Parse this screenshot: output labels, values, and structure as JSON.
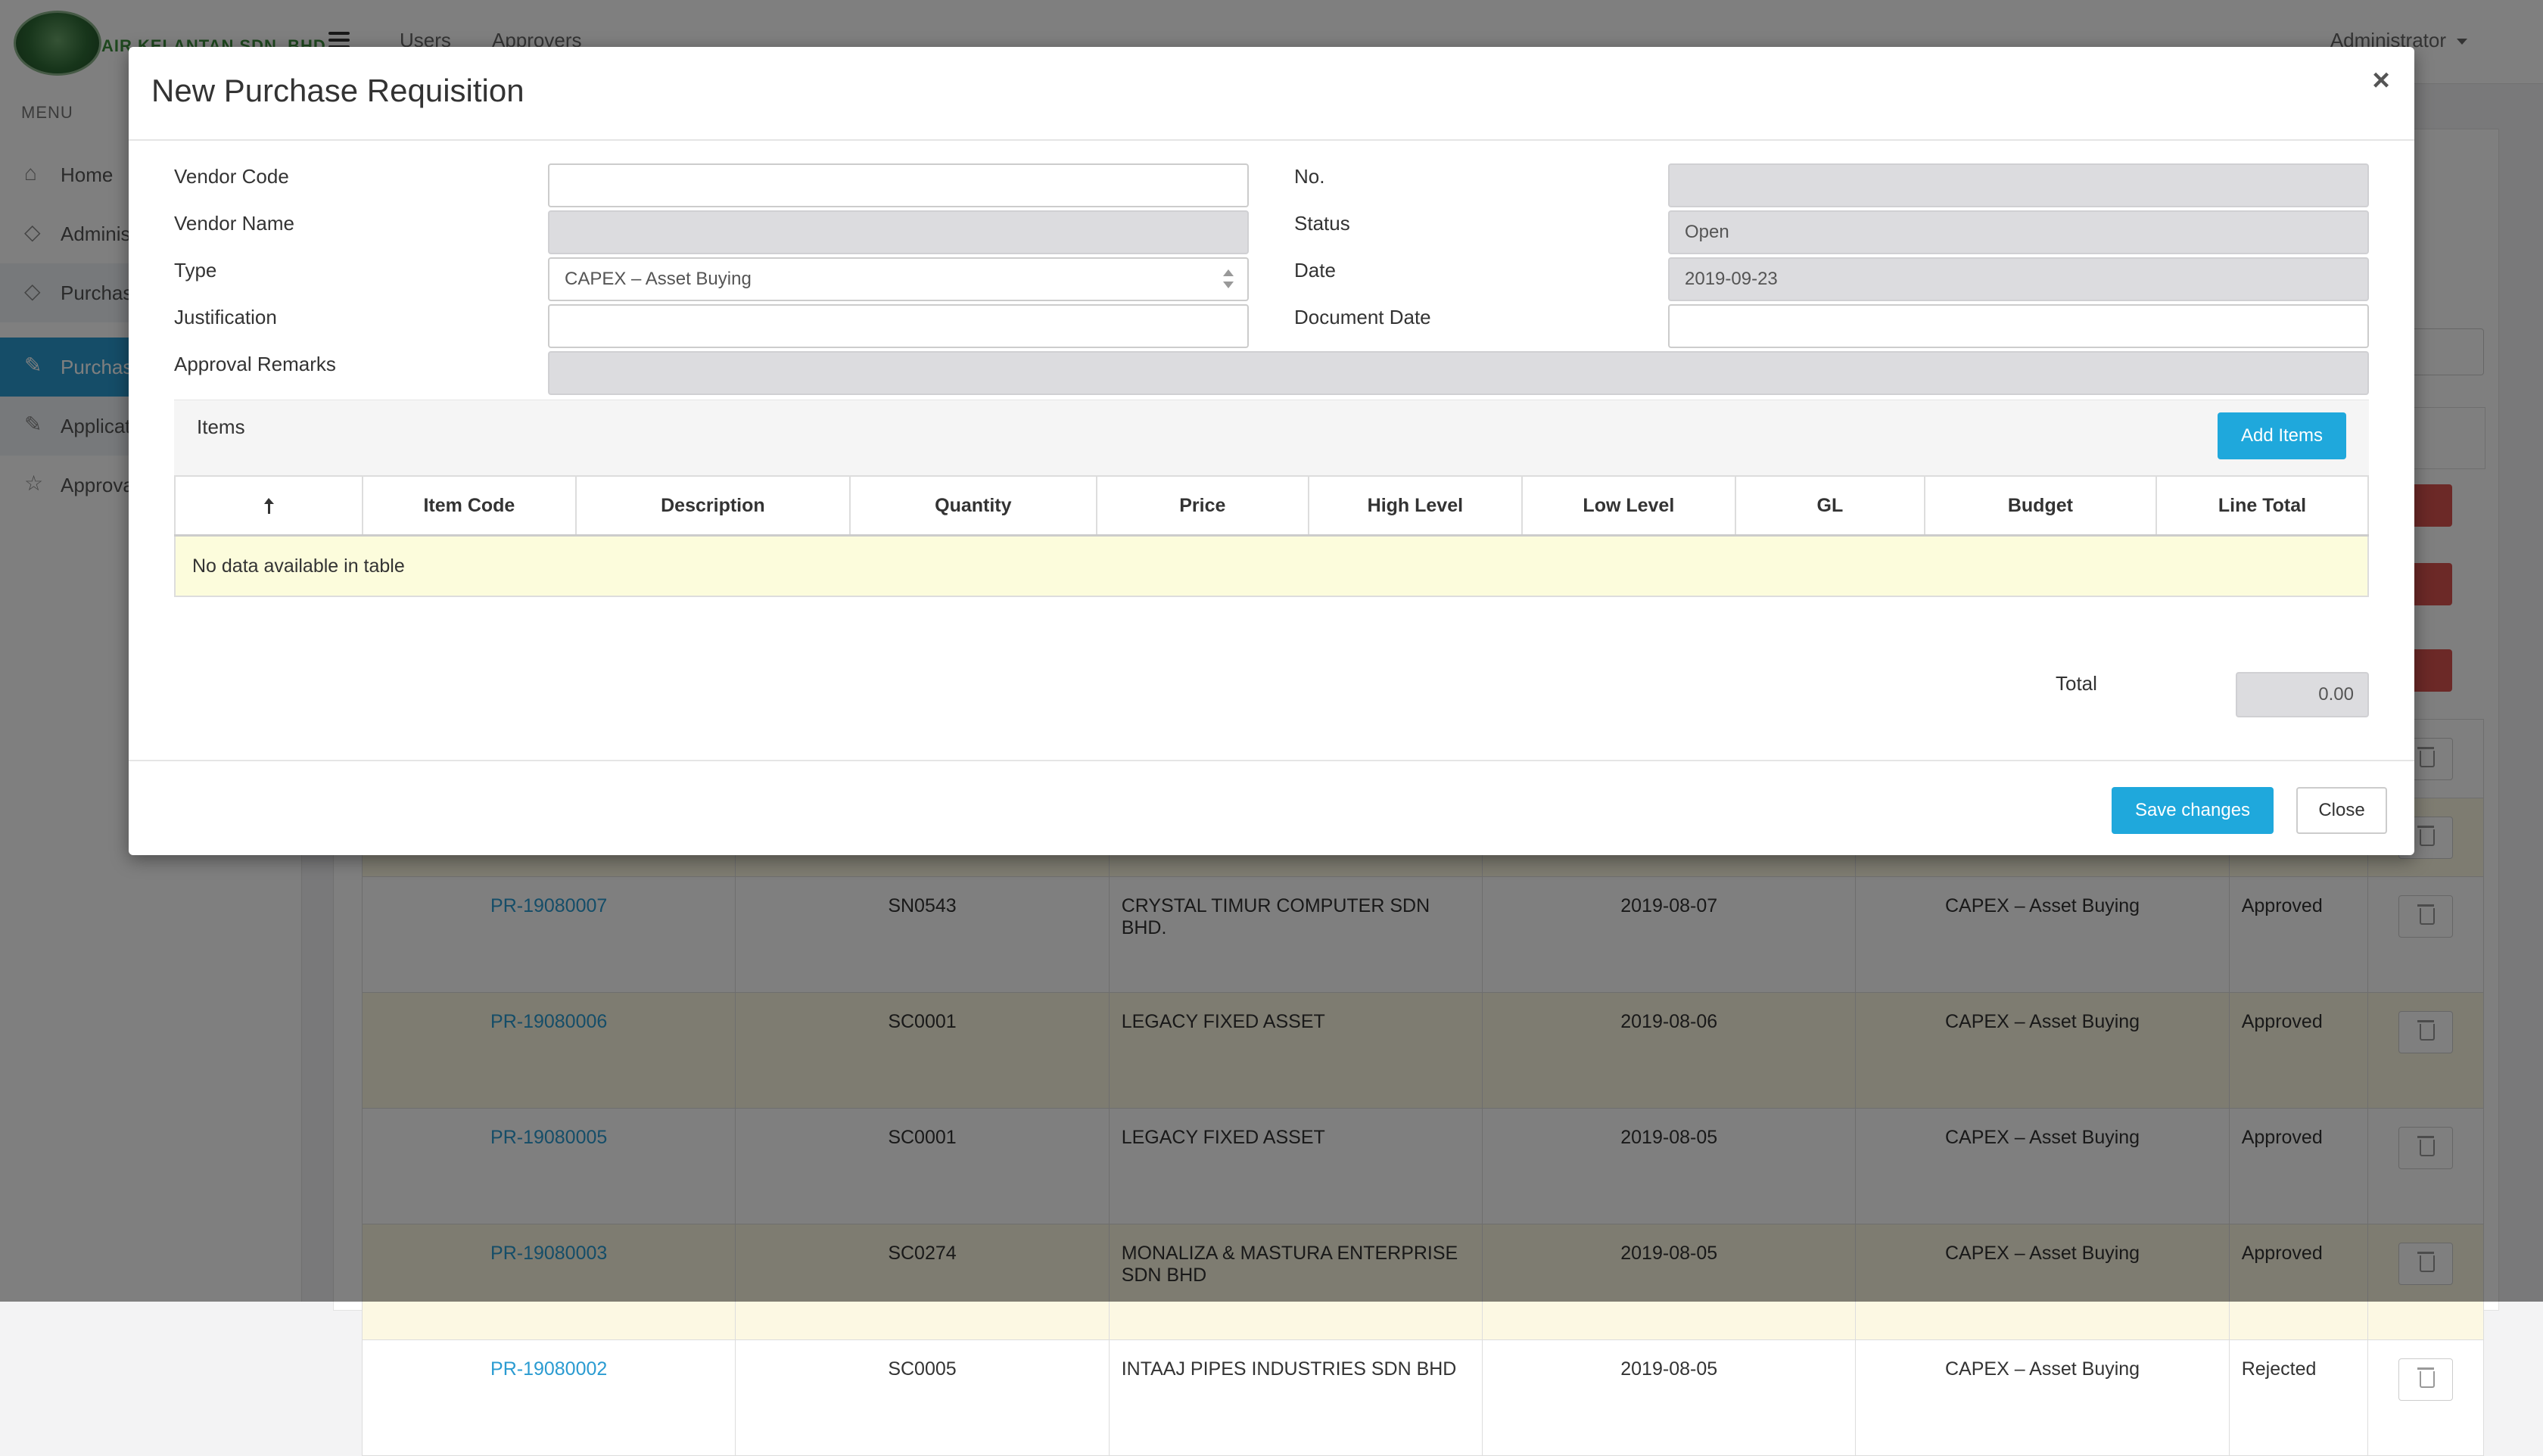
{
  "app": {
    "brand": "AIR KELANTAN SDN. BHD.",
    "nav": [
      "Users",
      "Approvers"
    ],
    "user_menu": "Administrator"
  },
  "sidebar": {
    "header": "MENU",
    "items": [
      {
        "label": "Home",
        "icon": "home-icon"
      },
      {
        "label": "Administration",
        "icon": "tags-icon"
      },
      {
        "label": "Purchase",
        "icon": "tags-icon"
      },
      {
        "label": "Purchase Requisition",
        "icon": "edit-icon"
      },
      {
        "label": "Application",
        "icon": "edit-icon"
      },
      {
        "label": "Approval",
        "icon": "star-icon"
      }
    ]
  },
  "background_table": {
    "rows": [
      {
        "no": "PR-19080007",
        "code": "SN0543",
        "vendor": "CRYSTAL TIMUR COMPUTER SDN BHD.",
        "date": "2019-08-07",
        "type": "CAPEX – Asset Buying",
        "status": "Approved"
      },
      {
        "no": "PR-19080006",
        "code": "SC0001",
        "vendor": "LEGACY FIXED ASSET",
        "date": "2019-08-06",
        "type": "CAPEX – Asset Buying",
        "status": "Approved"
      },
      {
        "no": "PR-19080005",
        "code": "SC0001",
        "vendor": "LEGACY FIXED ASSET",
        "date": "2019-08-05",
        "type": "CAPEX – Asset Buying",
        "status": "Approved"
      },
      {
        "no": "PR-19080003",
        "code": "SC0274",
        "vendor": "MONALIZA & MASTURA ENTERPRISE SDN BHD",
        "date": "2019-08-05",
        "type": "CAPEX – Asset Buying",
        "status": "Approved"
      },
      {
        "no": "PR-19080002",
        "code": "SC0005",
        "vendor": "INTAAJ PIPES INDUSTRIES SDN BHD",
        "date": "2019-08-05",
        "type": "CAPEX – Asset Buying",
        "status": "Rejected"
      }
    ]
  },
  "modal": {
    "title": "New Purchase Requisition",
    "close_glyph": "×",
    "fields": {
      "vendor_code": {
        "label": "Vendor Code",
        "value": ""
      },
      "vendor_name": {
        "label": "Vendor Name",
        "value": ""
      },
      "type": {
        "label": "Type",
        "value": "CAPEX – Asset Buying"
      },
      "justification": {
        "label": "Justification",
        "value": ""
      },
      "approval_remarks": {
        "label": "Approval Remarks",
        "value": ""
      },
      "no": {
        "label": "No.",
        "value": ""
      },
      "status": {
        "label": "Status",
        "value": "Open"
      },
      "date": {
        "label": "Date",
        "value": "2019-09-23"
      },
      "document_date": {
        "label": "Document Date",
        "value": ""
      }
    },
    "items": {
      "title": "Items",
      "add_button": "Add Items",
      "columns": [
        "Item Code",
        "Description",
        "Quantity",
        "Price",
        "High Level",
        "Low Level",
        "GL",
        "Budget",
        "Line Total"
      ],
      "empty_message": "No data available in table"
    },
    "total": {
      "label": "Total",
      "value": "0.00"
    },
    "footer": {
      "save": "Save changes",
      "close": "Close"
    }
  },
  "colors": {
    "primary": "#1fa8dc",
    "danger": "#d9534f",
    "highlight_row": "#fcf8e3",
    "sidebar_active": "#2a9bd1"
  }
}
